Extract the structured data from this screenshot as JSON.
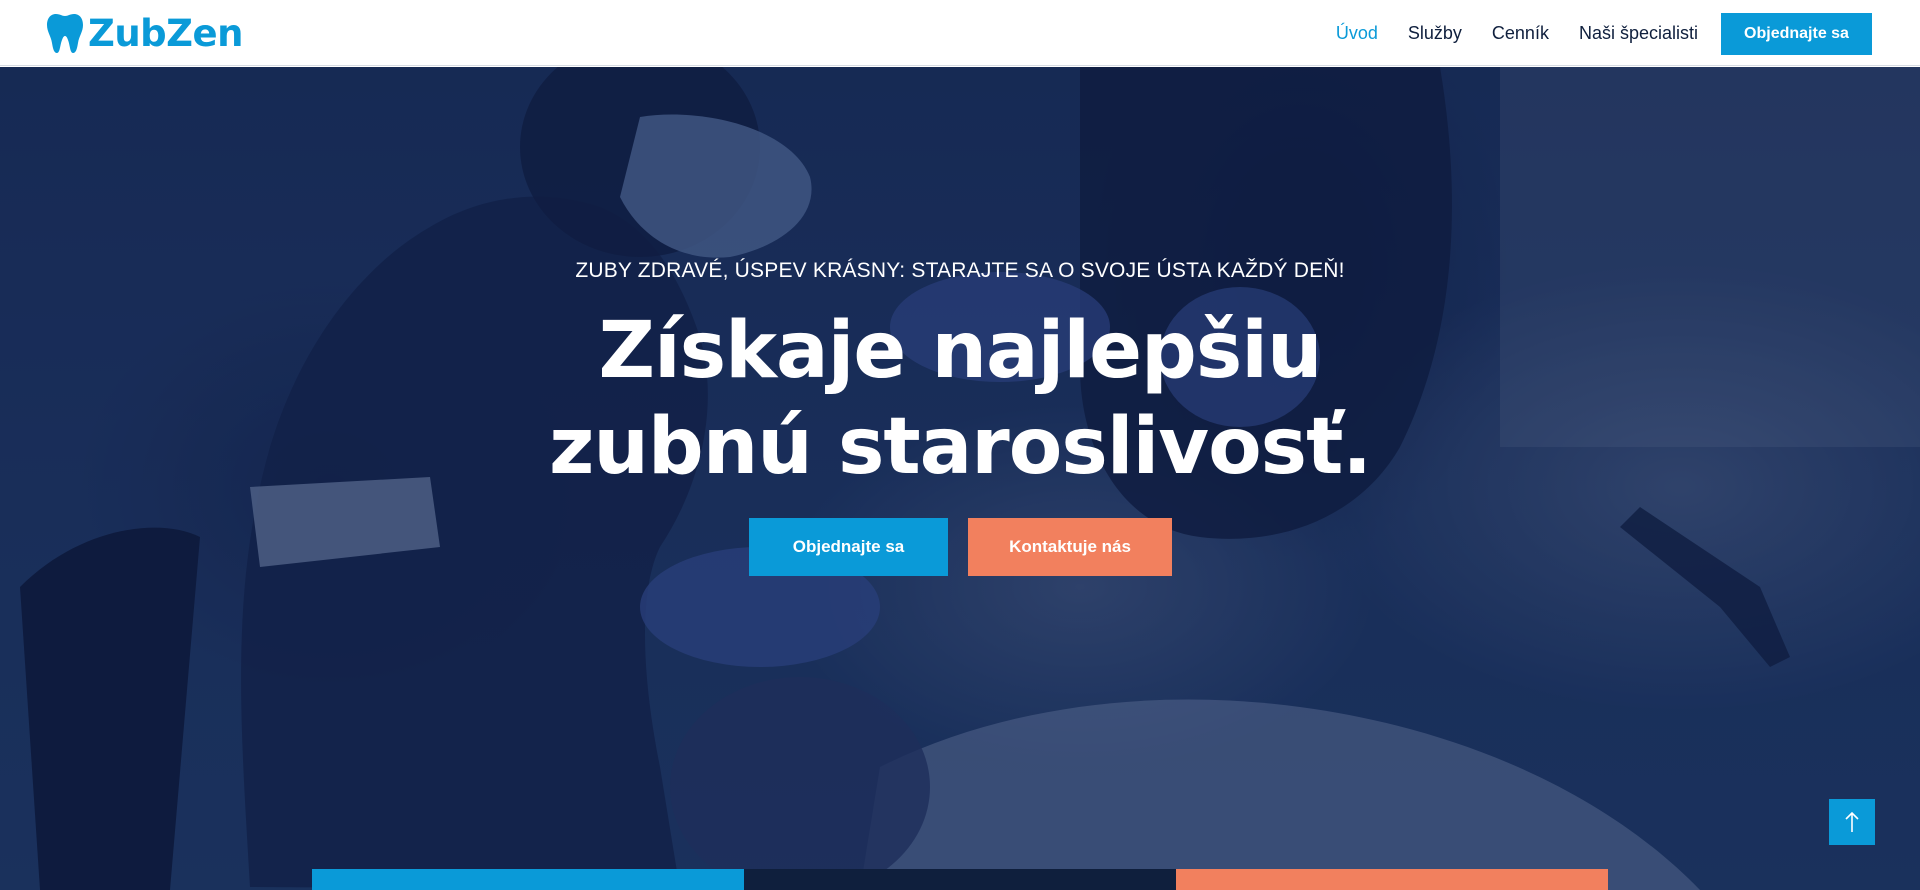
{
  "brand": {
    "name": "ZubZen",
    "icon": "tooth-icon",
    "color": "#0a9ad8"
  },
  "nav": {
    "items": [
      {
        "label": "Úvod",
        "active": true
      },
      {
        "label": "Služby",
        "active": false
      },
      {
        "label": "Cenník",
        "active": false
      },
      {
        "label": "Naši špecialisti",
        "active": false
      }
    ],
    "cta_label": "Objednajte sa"
  },
  "hero": {
    "tagline": "ZUBY ZDRAVÉ, ÚSPEV KRÁSNY: STARAJTE SA O SVOJE ÚSTA KAŽDÝ DEŇ!",
    "title_line1": "Získaje najlepšiu",
    "title_line2": "zubnú staroslivosť.",
    "primary_button": "Objednajte sa",
    "secondary_button": "Kontaktuje nás"
  },
  "scroll_top": {
    "icon": "arrow-up-icon"
  },
  "colors": {
    "primary": "#0a9ad8",
    "accent": "#f2805e",
    "navy": "#0f1f3d",
    "hero_overlay": "#1f3766"
  }
}
